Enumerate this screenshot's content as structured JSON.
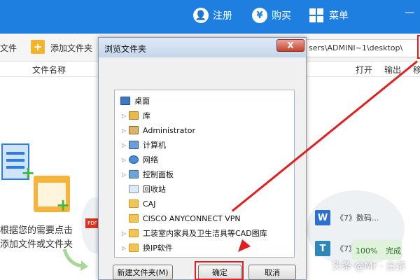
{
  "header": {
    "register_label": "注册",
    "buy_label": "购买",
    "menu_label": "菜单",
    "minimize": "—",
    "user_icon_glyph": "👤",
    "yen_icon_glyph": "¥"
  },
  "toolbar": {
    "file_fragment": "文件",
    "add_folder_label": "添加文件夹",
    "path_value": "sers\\ADMINI~1\\desktop\\"
  },
  "columns": {
    "file_name": "文件名称",
    "open": "打开",
    "output": "输出",
    "move_fragment": "移"
  },
  "empty_hint": {
    "line1": "根据您的需要点击",
    "line2": "添加文件或文件夹"
  },
  "right_list": [
    {
      "icon_letter": "W",
      "text": "《7》数码..."
    },
    {
      "icon_letter": "T",
      "text": "《7》..."
    }
  ],
  "progress": {
    "percent": "100%",
    "status": "完成"
  },
  "pdf_badge": "PDF",
  "dialog": {
    "title": "浏览文件夹",
    "close": "X",
    "tree": [
      {
        "label": "桌面",
        "icon": "desktop",
        "expand": false,
        "indent": 0
      },
      {
        "label": "库",
        "icon": "lib",
        "expand": true,
        "indent": 1
      },
      {
        "label": "Administrator",
        "icon": "user",
        "expand": true,
        "indent": 1
      },
      {
        "label": "计算机",
        "icon": "pc",
        "expand": true,
        "indent": 1
      },
      {
        "label": "网络",
        "icon": "net",
        "expand": true,
        "indent": 1
      },
      {
        "label": "控制面板",
        "icon": "cp",
        "expand": true,
        "indent": 1
      },
      {
        "label": "回收站",
        "icon": "bin",
        "expand": false,
        "indent": 1
      },
      {
        "label": "CAJ",
        "icon": "folder",
        "expand": false,
        "indent": 1
      },
      {
        "label": "CISCO ANYCONNECT VPN",
        "icon": "folder",
        "expand": false,
        "indent": 1
      },
      {
        "label": "工装室内家具及卫生洁具等CAD图库",
        "icon": "folder",
        "expand": true,
        "indent": 1
      },
      {
        "label": "换IP软件",
        "icon": "folder",
        "expand": true,
        "indent": 1
      }
    ],
    "new_folder_button": "新建文件夹(M)",
    "ok_button": "确定",
    "cancel_button": "取消"
  },
  "watermark": "头条 @Mr · 白茶",
  "colors": {
    "header_blue": "#1f7fe0",
    "highlight_red": "#e02020",
    "folder_yellow": "#f2c553"
  }
}
